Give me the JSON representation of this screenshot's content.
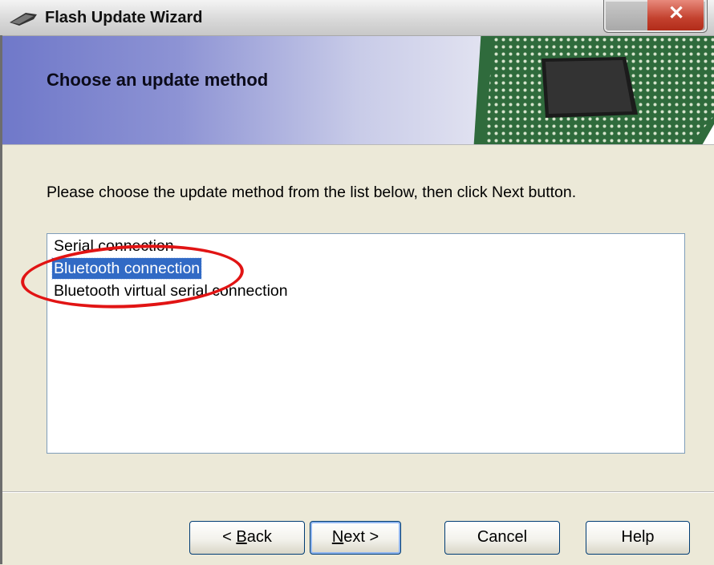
{
  "window": {
    "title": "Flash Update Wizard"
  },
  "header": {
    "title": "Choose an update method"
  },
  "main": {
    "instruction": "Please choose the update method from the list below, then click Next button.",
    "methods": [
      {
        "label": "Serial connection",
        "selected": false
      },
      {
        "label": "Bluetooth connection",
        "selected": true
      },
      {
        "label": "Bluetooth virtual serial connection",
        "selected": false
      }
    ]
  },
  "buttons": {
    "back": {
      "prefix": "< ",
      "mnemonic": "B",
      "rest": "ack"
    },
    "next": {
      "mnemonic": "N",
      "rest": "ext >"
    },
    "cancel": "Cancel",
    "help": "Help"
  },
  "icons": {
    "title": "wizard-app-icon",
    "close": "close-icon",
    "banner": "chip-icon"
  },
  "colors": {
    "selection": "#316ac5",
    "annotation": "#e11414",
    "close_button": "#c3412e"
  }
}
